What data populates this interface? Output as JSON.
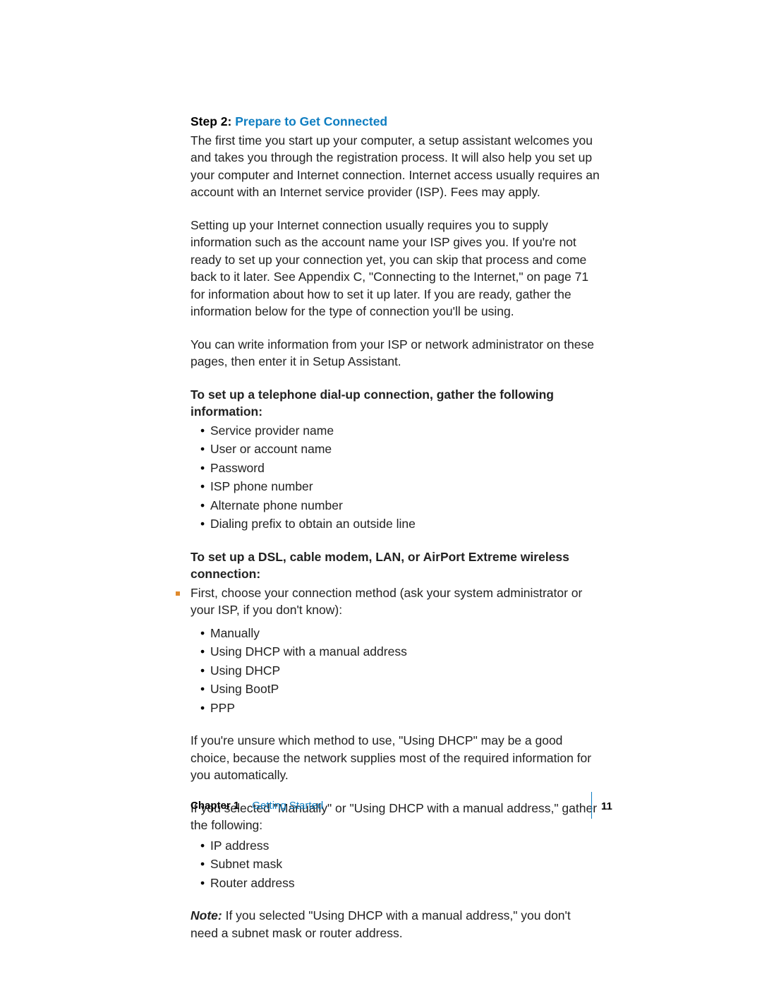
{
  "heading": {
    "step_label": "Step 2:",
    "step_title": "Prepare to Get Connected"
  },
  "paragraphs": {
    "p1": "The first time you start up your computer, a setup assistant welcomes you and takes you through the registration process. It will also help you set up your computer and Internet connection. Internet access usually requires an account with an Internet service provider (ISP). Fees may apply.",
    "p2": "Setting up your Internet connection usually requires you to supply information such as the account name your ISP gives you. If you're not ready to set up your connection yet, you can skip that process and come back to it later. See Appendix C, \"Connecting to the Internet,\" on page 71 for information about how to set it up later. If you are ready, gather the information below for the type of connection you'll be using.",
    "p3": "You can write information from your ISP or network administrator on these pages, then enter it in Setup Assistant.",
    "dialup_head": "To set up a telephone dial-up connection, gather the following information:",
    "dsl_head": "To set up a DSL, cable modem, LAN, or AirPort Extreme wireless connection:",
    "dsl_intro": "First, choose your connection method (ask your system administrator or your ISP, if you don't know):",
    "dhcp_hint": "If you're unsure which method to use, \"Using DHCP\" may be a good choice, because the network supplies most of the required information for you automatically.",
    "manual_intro": "If you selected \"Manually\" or \"Using DHCP with a manual address,\" gather the following:",
    "note_label": "Note:",
    "note_text": "  If you selected \"Using DHCP with a manual address,\" you don't need a subnet mask or router address."
  },
  "lists": {
    "dialup": {
      "i0": "Service provider name",
      "i1": "User or account name",
      "i2": "Password",
      "i3": "ISP phone number",
      "i4": "Alternate phone number",
      "i5": "Dialing prefix to obtain an outside line"
    },
    "methods": {
      "i0": "Manually",
      "i1": "Using DHCP with a manual address",
      "i2": "Using DHCP",
      "i3": "Using BootP",
      "i4": "PPP"
    },
    "manual": {
      "i0": "IP address",
      "i1": "Subnet mask",
      "i2": "Router address"
    }
  },
  "footer": {
    "chapter_label": "Chapter 1",
    "chapter_title": "Getting Started",
    "page_number": "11"
  }
}
